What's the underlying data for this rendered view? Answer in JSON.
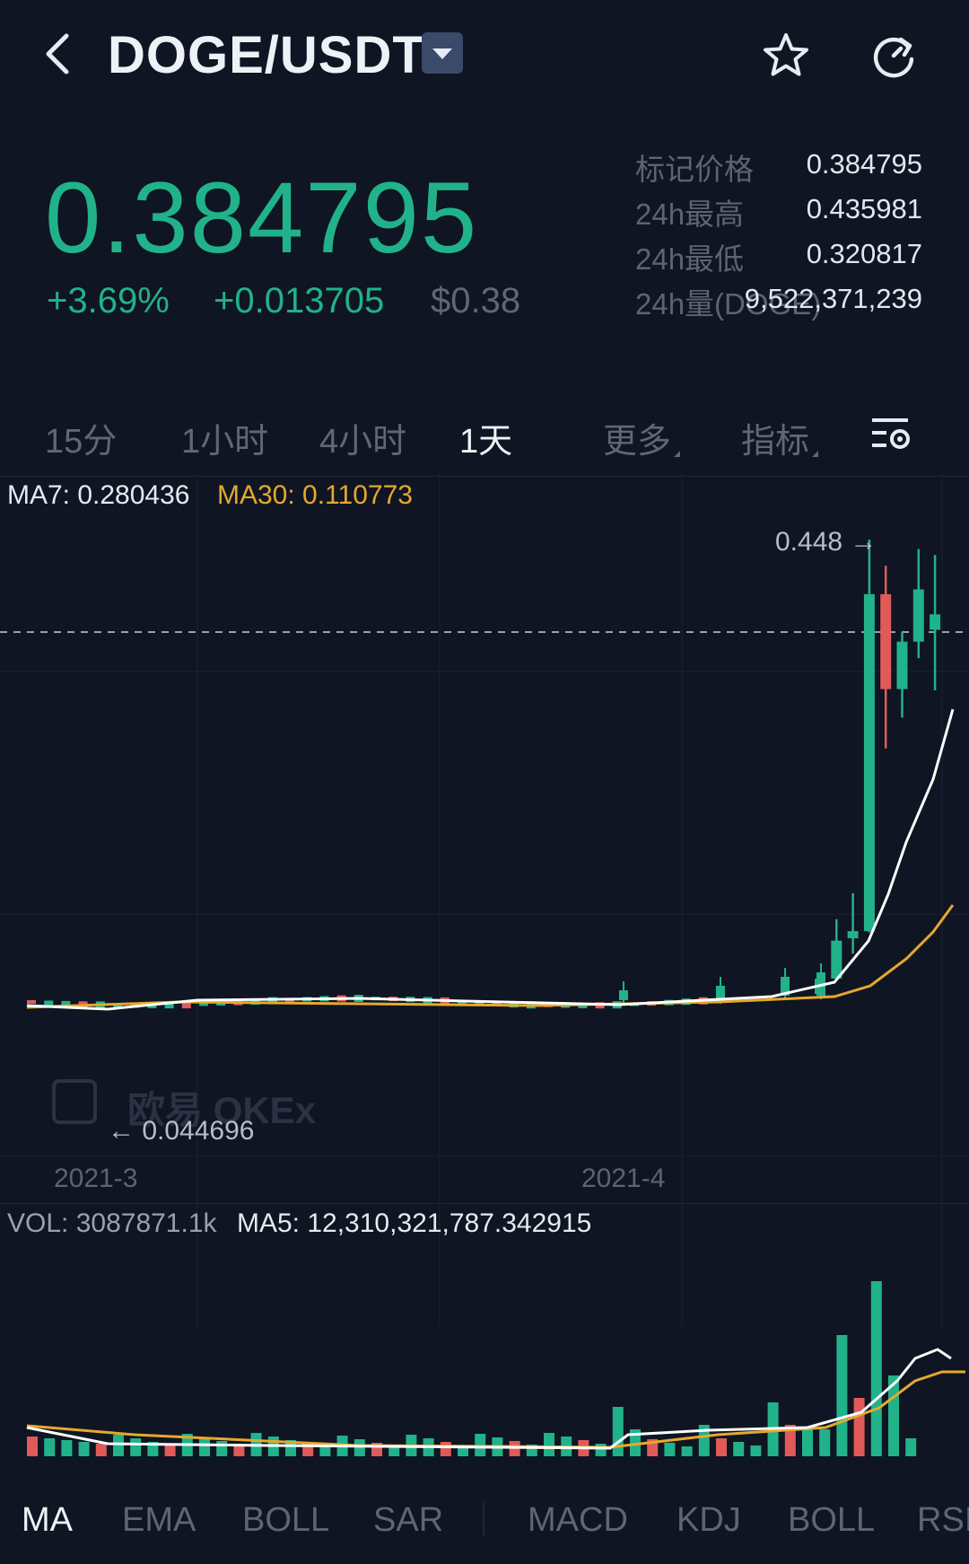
{
  "header": {
    "pair": "DOGE/USDT"
  },
  "price": {
    "last": "0.384795",
    "change_pct": "+3.69%",
    "change_abs": "+0.013705",
    "usd": "$0.38"
  },
  "stats": [
    {
      "label": "标记价格",
      "value": "0.384795"
    },
    {
      "label": "24h最高",
      "value": "0.435981"
    },
    {
      "label": "24h最低",
      "value": "0.320817"
    },
    {
      "label": "24h量(DOGE)",
      "value": "9,522,371,239"
    }
  ],
  "timeframes": [
    {
      "label": "15分",
      "active": false
    },
    {
      "label": "1小时",
      "active": false
    },
    {
      "label": "4小时",
      "active": false
    },
    {
      "label": "1天",
      "active": true
    },
    {
      "label": "更多",
      "active": false
    },
    {
      "label": "指标",
      "active": false
    }
  ],
  "legend": {
    "ma7": "MA7: 0.280436",
    "ma30": "MA30: 0.110773"
  },
  "price_labels": {
    "high_marker": "0.448 →",
    "low_marker": "← 0.044696"
  },
  "x_ticks": [
    "2021-3",
    "2021-4"
  ],
  "watermark": "欧易 OKEx",
  "volume": {
    "vol": "VOL: 3087871.1k",
    "ma5": "MA5: 12,310,321,787.342915"
  },
  "indicators": [
    "MA",
    "EMA",
    "BOLL",
    "SAR",
    "MACD",
    "KDJ",
    "BOLL",
    "RSI"
  ],
  "colors": {
    "up": "#21b28a",
    "down": "#e05a5a",
    "ma7": "#ffffff",
    "ma30": "#e5a92d",
    "bg": "#0f1522"
  },
  "chart_data": {
    "type": "candlestick",
    "x": [
      "2021-3",
      "2021-4"
    ],
    "candles_recent": [
      {
        "o": 0.065,
        "h": 0.079,
        "l": 0.063,
        "c": 0.078
      },
      {
        "o": 0.078,
        "h": 0.128,
        "l": 0.077,
        "c": 0.11
      },
      {
        "o": 0.112,
        "h": 0.15,
        "l": 0.099,
        "c": 0.118
      },
      {
        "o": 0.118,
        "h": 0.448,
        "l": 0.117,
        "c": 0.402
      },
      {
        "o": 0.402,
        "h": 0.426,
        "l": 0.272,
        "c": 0.322
      },
      {
        "o": 0.322,
        "h": 0.37,
        "l": 0.298,
        "c": 0.362
      },
      {
        "o": 0.362,
        "h": 0.44,
        "l": 0.348,
        "c": 0.406
      },
      {
        "o": 0.372,
        "h": 0.435,
        "l": 0.321,
        "c": 0.385
      }
    ],
    "high": 0.448,
    "low": 0.044696,
    "last": 0.384795
  }
}
